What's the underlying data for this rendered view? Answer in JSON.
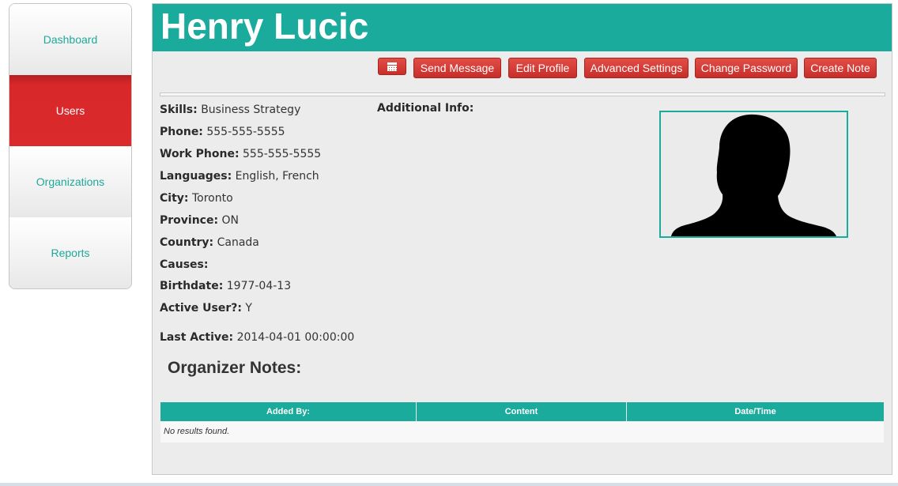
{
  "sidebar": {
    "items": [
      {
        "label": "Dashboard",
        "active": false
      },
      {
        "label": "Users",
        "active": true
      },
      {
        "label": "Organizations",
        "active": false
      },
      {
        "label": "Reports",
        "active": false
      }
    ]
  },
  "profile": {
    "name": "Henry Lucic"
  },
  "toolbar": {
    "calendar_icon": "calendar-icon",
    "send_message": "Send Message",
    "edit_profile": "Edit Profile",
    "advanced_settings": "Advanced Settings",
    "change_password": "Change Password",
    "create_note": "Create Note"
  },
  "details": {
    "skills_label": "Skills:",
    "skills_value": "Business Strategy",
    "phone_label": "Phone:",
    "phone_value": "555-555-5555",
    "work_phone_label": "Work Phone:",
    "work_phone_value": "555-555-5555",
    "languages_label": "Languages:",
    "languages_value": "English, French",
    "city_label": "City:",
    "city_value": "Toronto",
    "province_label": "Province:",
    "province_value": "ON",
    "country_label": "Country:",
    "country_value": "Canada",
    "causes_label": "Causes:",
    "causes_value": "",
    "birthdate_label": "Birthdate:",
    "birthdate_value": "1977-04-13",
    "active_label": "Active User?:",
    "active_value": "Y",
    "last_active_label": "Last Active:",
    "last_active_value": "2014-04-01 00:00:00"
  },
  "additional_info_label": "Additional Info:",
  "notes": {
    "title": "Organizer Notes:",
    "columns": [
      "Added By:",
      "Content",
      "Date/Time"
    ],
    "empty_text": "No results found."
  },
  "colors": {
    "accent": "#1aab9d",
    "danger": "#d9272a"
  }
}
